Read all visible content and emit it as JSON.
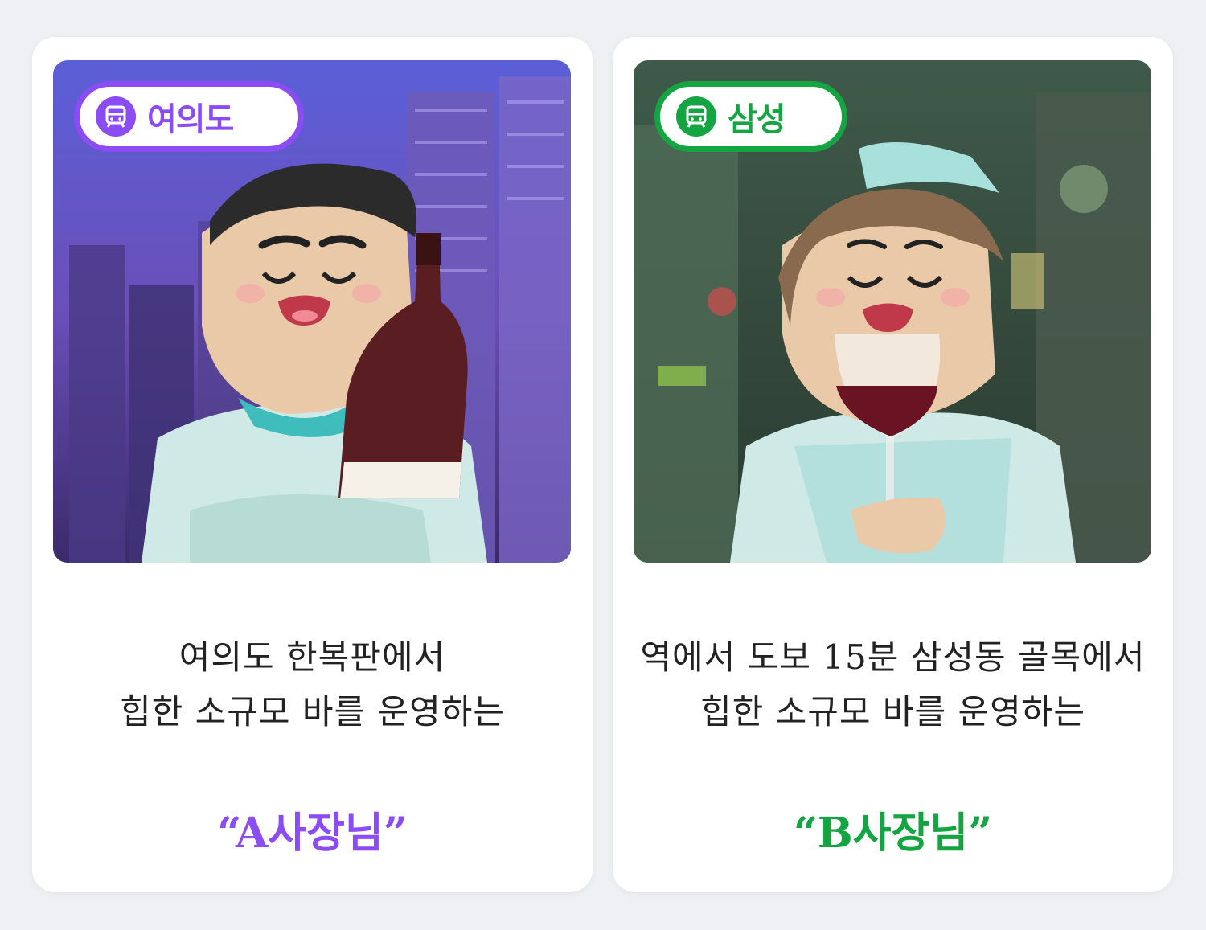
{
  "cards": [
    {
      "station": "여의도",
      "station_icon": "subway-icon",
      "line1": "여의도 한복판에서",
      "line2": "힙한 소규모 바를 운영하는",
      "owner": "“A사장님”",
      "accent": "#8b4cf3"
    },
    {
      "station": "삼성",
      "station_icon": "subway-icon",
      "line1": "역에서 도보 15분 삼성동 골목에서",
      "line2": "힙한 소규모 바를 운영하는",
      "owner": "“B사장님”",
      "accent": "#14a542"
    }
  ]
}
